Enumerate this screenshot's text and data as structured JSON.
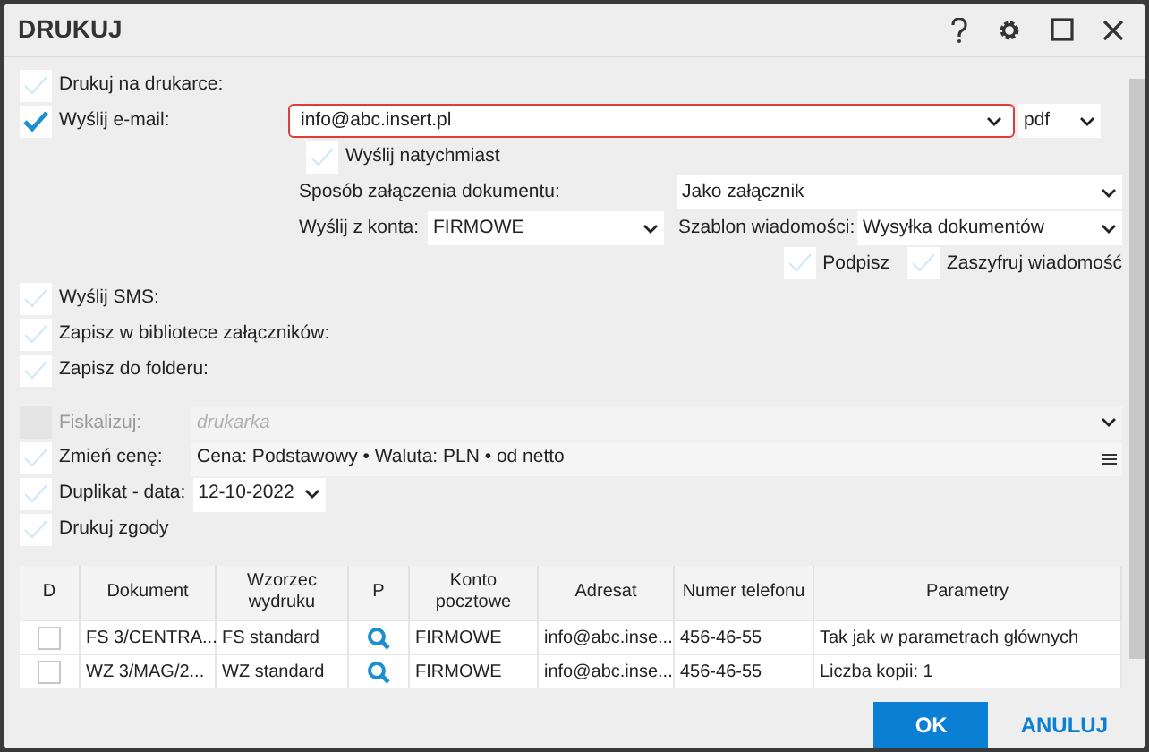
{
  "window": {
    "title": "DRUKUJ"
  },
  "print_to_printer": {
    "label": "Drukuj na drukarce:",
    "checked": false
  },
  "email": {
    "label": "Wyślij e-mail:",
    "checked": true,
    "address": "info@abc.insert.pl",
    "format": "pdf",
    "send_now": {
      "label": "Wyślij natychmiast",
      "checked": false
    },
    "attachment_mode": {
      "label": "Sposób załączenia dokumentu:",
      "value": "Jako załącznik"
    },
    "account": {
      "label": "Wyślij z konta:",
      "value": "FIRMOWE"
    },
    "template": {
      "label": "Szablon wiadomości:",
      "value": "Wysyłka dokumentów"
    },
    "sign": {
      "label": "Podpisz",
      "checked": false
    },
    "encrypt": {
      "label": "Zaszyfruj wiadomość",
      "checked": false
    }
  },
  "other_options": [
    {
      "label": "Wyślij SMS:",
      "checked": false
    },
    {
      "label": "Zapisz w bibliotece załączników:",
      "checked": false
    },
    {
      "label": "Zapisz do folderu:",
      "checked": false
    }
  ],
  "fiscalize": {
    "label": "Fiskalizuj:",
    "placeholder": "drukarka",
    "disabled": true
  },
  "change_price": {
    "label": "Zmień cenę:",
    "checked": false,
    "value": "Cena: Podstawowy • Waluta: PLN • od netto"
  },
  "duplicate": {
    "label": "Duplikat - data:",
    "checked": false,
    "value": "12-10-2022"
  },
  "print_consents": {
    "label": "Drukuj zgody",
    "checked": false
  },
  "table": {
    "columns": [
      "D",
      "Dokument",
      "Wzorzec wydruku",
      "P",
      "Konto pocztowe",
      "Adresat",
      "Numer telefonu",
      "Parametry"
    ],
    "rows": [
      {
        "cells": [
          {
            "kind": "checkbox",
            "checked": false
          },
          {
            "kind": "text",
            "text": "FS 3/CENTRA..."
          },
          {
            "kind": "text",
            "text": "FS standard"
          },
          {
            "kind": "preview"
          },
          {
            "kind": "text",
            "text": "FIRMOWE"
          },
          {
            "kind": "text",
            "text": "info@abc.inse..."
          },
          {
            "kind": "text",
            "text": "456-46-55"
          },
          {
            "kind": "text",
            "text": "Tak jak w parametrach głównych"
          }
        ]
      },
      {
        "cells": [
          {
            "kind": "checkbox",
            "checked": false
          },
          {
            "kind": "text",
            "text": "WZ 3/MAG/2..."
          },
          {
            "kind": "text",
            "text": "WZ standard"
          },
          {
            "kind": "preview"
          },
          {
            "kind": "text",
            "text": "FIRMOWE"
          },
          {
            "kind": "text",
            "text": "info@abc.inse..."
          },
          {
            "kind": "text",
            "text": "456-46-55"
          },
          {
            "kind": "text",
            "text": "Liczba kopii: 1"
          }
        ]
      }
    ]
  },
  "buttons": [
    {
      "label": "OK",
      "kind": "primary"
    },
    {
      "label": "ANULUJ",
      "kind": "text"
    }
  ]
}
